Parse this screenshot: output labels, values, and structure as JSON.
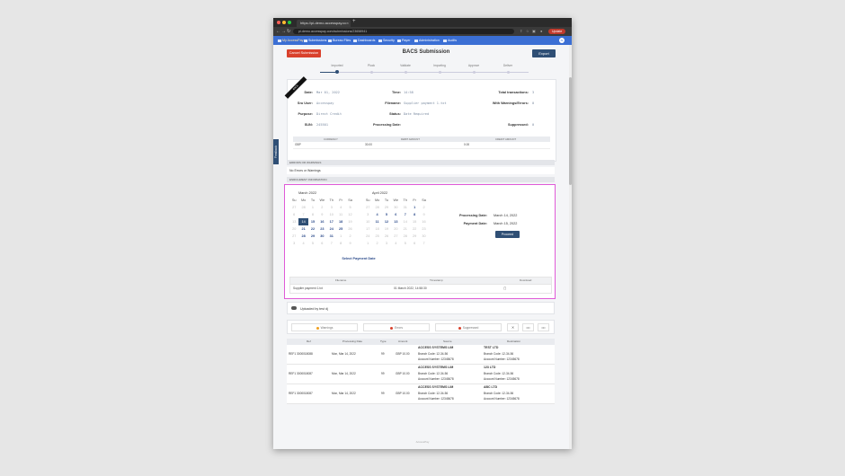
{
  "browser": {
    "tab_title": "https://pi-demo.accesspay.co",
    "tab_close": "×",
    "new_tab": "+",
    "url": "pi-demo.accesspay.com/submissions/23658941",
    "update_label": "Update"
  },
  "appnav": {
    "items": [
      {
        "label": "My AccessPay",
        "active": true
      },
      {
        "label": "Submissions"
      },
      {
        "label": "Bureau Files"
      },
      {
        "label": "Dashboards"
      },
      {
        "label": "Security"
      },
      {
        "label": "Payer"
      },
      {
        "label": "Administration"
      },
      {
        "label": "Audits"
      }
    ],
    "avatar": "IS"
  },
  "feedback_label": "Feedback",
  "header": {
    "cancel_label": "Cancel Submission",
    "title": "BACS Submission",
    "export_label": "Export"
  },
  "stepper": {
    "steps": [
      "Imported",
      "Pluck",
      "Validate",
      "Importing",
      "Approve",
      "Deliver"
    ],
    "active_index": 0
  },
  "summary": {
    "ribbon": "BACS",
    "date_label": "Date:",
    "date_value": "Mar 01, 2022",
    "time_label": "Time:",
    "time_value": "14:58",
    "total_tx_label": "Total transactions:",
    "total_tx_value": "3",
    "sru_label": "Sru User:",
    "sru_value": "Accesspay",
    "filename_label": "Filename:",
    "filename_value": "Supplier payment 1.txt",
    "warnings_label": "With Warnings/Errors:",
    "warnings_value": "0",
    "purpose_label": "Purpose:",
    "purpose_value": "Direct Credit",
    "status_label": "Status:",
    "status_value": "Date Required",
    "sun_label": "SUN:",
    "sun_value": "245501",
    "proc_date_label": "Processing Date:",
    "proc_date_value": "",
    "suppressed_label": "Suppressed:",
    "suppressed_value": "0",
    "money_table": {
      "headers": [
        "CURRENCY",
        "DEBIT AMOUNT",
        "CREDIT AMOUNT"
      ],
      "row": [
        "GBP",
        "30.00",
        "0.00"
      ]
    }
  },
  "sections": {
    "errors_title": "ERRORS OR WARNINGS",
    "errors_text": "No Errors or Warnings",
    "enrichment_title": "ENRICHMENT INFORMATION"
  },
  "calendar_march": {
    "title": "March 2022",
    "days": [
      "Su",
      "Mo",
      "Tu",
      "We",
      "Th",
      "Fr",
      "Sa"
    ],
    "cells": [
      {
        "d": "27",
        "s": "o"
      },
      {
        "d": "28",
        "s": "o"
      },
      {
        "d": "1",
        "s": "o"
      },
      {
        "d": "2",
        "s": "o"
      },
      {
        "d": "3",
        "s": "o"
      },
      {
        "d": "4",
        "s": "o"
      },
      {
        "d": "5",
        "s": "o"
      },
      {
        "d": "6",
        "s": "o"
      },
      {
        "d": "7",
        "s": "o"
      },
      {
        "d": "8",
        "s": "o"
      },
      {
        "d": "9",
        "s": "o"
      },
      {
        "d": "10",
        "s": "o"
      },
      {
        "d": "11",
        "s": "o"
      },
      {
        "d": "12",
        "s": "o"
      },
      {
        "d": "13",
        "s": "o"
      },
      {
        "d": "14",
        "s": "sel"
      },
      {
        "d": "15",
        "s": "cur"
      },
      {
        "d": "16",
        "s": "cur"
      },
      {
        "d": "17",
        "s": "cur"
      },
      {
        "d": "18",
        "s": "cur"
      },
      {
        "d": "19",
        "s": "o"
      },
      {
        "d": "20",
        "s": "o"
      },
      {
        "d": "21",
        "s": "cur"
      },
      {
        "d": "22",
        "s": "cur"
      },
      {
        "d": "23",
        "s": "cur"
      },
      {
        "d": "24",
        "s": "cur"
      },
      {
        "d": "25",
        "s": "cur"
      },
      {
        "d": "26",
        "s": "o"
      },
      {
        "d": "27",
        "s": "o"
      },
      {
        "d": "28",
        "s": "cur"
      },
      {
        "d": "29",
        "s": "cur"
      },
      {
        "d": "30",
        "s": "cur"
      },
      {
        "d": "31",
        "s": "cur"
      },
      {
        "d": "1",
        "s": "o"
      },
      {
        "d": "2",
        "s": "o"
      },
      {
        "d": "3",
        "s": "o"
      },
      {
        "d": "4",
        "s": "o"
      },
      {
        "d": "5",
        "s": "o"
      },
      {
        "d": "6",
        "s": "o"
      },
      {
        "d": "7",
        "s": "o"
      },
      {
        "d": "8",
        "s": "o"
      },
      {
        "d": "9",
        "s": "o"
      }
    ]
  },
  "calendar_april": {
    "title": "April 2022",
    "days": [
      "Su",
      "Mo",
      "Tu",
      "We",
      "Th",
      "Fr",
      "Sa"
    ],
    "cells": [
      {
        "d": "27",
        "s": "o"
      },
      {
        "d": "28",
        "s": "o"
      },
      {
        "d": "29",
        "s": "o"
      },
      {
        "d": "30",
        "s": "o"
      },
      {
        "d": "31",
        "s": "o"
      },
      {
        "d": "1",
        "s": "cur"
      },
      {
        "d": "2",
        "s": "o"
      },
      {
        "d": "3",
        "s": "o"
      },
      {
        "d": "4",
        "s": "cur"
      },
      {
        "d": "5",
        "s": "cur"
      },
      {
        "d": "6",
        "s": "cur"
      },
      {
        "d": "7",
        "s": "cur"
      },
      {
        "d": "8",
        "s": "cur"
      },
      {
        "d": "9",
        "s": "o"
      },
      {
        "d": "10",
        "s": "o"
      },
      {
        "d": "11",
        "s": "cur"
      },
      {
        "d": "12",
        "s": "cur"
      },
      {
        "d": "13",
        "s": "cur"
      },
      {
        "d": "14",
        "s": "o"
      },
      {
        "d": "15",
        "s": "o"
      },
      {
        "d": "16",
        "s": "o"
      },
      {
        "d": "17",
        "s": "o"
      },
      {
        "d": "18",
        "s": "o"
      },
      {
        "d": "19",
        "s": "o"
      },
      {
        "d": "20",
        "s": "o"
      },
      {
        "d": "21",
        "s": "o"
      },
      {
        "d": "22",
        "s": "o"
      },
      {
        "d": "23",
        "s": "o"
      },
      {
        "d": "24",
        "s": "o"
      },
      {
        "d": "25",
        "s": "o"
      },
      {
        "d": "26",
        "s": "o"
      },
      {
        "d": "27",
        "s": "o"
      },
      {
        "d": "28",
        "s": "o"
      },
      {
        "d": "29",
        "s": "o"
      },
      {
        "d": "30",
        "s": "o"
      },
      {
        "d": "1",
        "s": "o"
      },
      {
        "d": "2",
        "s": "o"
      },
      {
        "d": "3",
        "s": "o"
      },
      {
        "d": "4",
        "s": "o"
      },
      {
        "d": "5",
        "s": "o"
      },
      {
        "d": "6",
        "s": "o"
      },
      {
        "d": "7",
        "s": "o"
      }
    ]
  },
  "payment": {
    "processing_label": "Processing Date:",
    "processing_value": "March 14, 2022",
    "payment_label": "Payment Date:",
    "payment_value": "March 15, 2022",
    "proceed_label": "Proceed",
    "select_link": "Select Payment Date"
  },
  "file_table": {
    "headers": [
      "Filename",
      "Timestamp",
      "Download"
    ],
    "row": [
      "Supplier payment 1.txt",
      "01 March 2022, 14:58:30",
      "▢"
    ]
  },
  "upload_text": "Uploaded by test dj",
  "filters": {
    "warnings": "Warnings",
    "errors": "Errors",
    "suppressed": "Suppressed",
    "clear": "✕",
    "more1": "•••",
    "more2": "•••"
  },
  "submissions": {
    "headers": [
      "Ref",
      "Processing Date",
      "Type",
      "Amount",
      "Source",
      "Destination"
    ],
    "rows": [
      {
        "ref": "REF1 3000018088",
        "date": "Mon, Mar 14, 2022",
        "type": "99",
        "amount": "GBP 10.00",
        "src_name": "ACCESS SYSTEMS LIM",
        "src_branch": "Branch Code: 12-34-56",
        "src_account": "Account Number: 12345678",
        "dst_name": "TEST LTD",
        "dst_branch": "Branch Code: 12-34-56",
        "dst_account": "Account Number: 12345678"
      },
      {
        "ref": "REF1 3000018087",
        "date": "Mon, Mar 14, 2022",
        "type": "99",
        "amount": "GBP 10.00",
        "src_name": "ACCESS SYSTEMS LIM",
        "src_branch": "Branch Code: 12-34-56",
        "src_account": "Account Number: 12345678",
        "dst_name": "123 LTD",
        "dst_branch": "Branch Code: 12-34-56",
        "dst_account": "Account Number: 12345678"
      },
      {
        "ref": "REF1 3000018087",
        "date": "Mon, Mar 14, 2022",
        "type": "99",
        "amount": "GBP 10.00",
        "src_name": "ACCESS SYSTEMS LIM",
        "src_branch": "Branch Code: 12-34-56",
        "src_account": "Account Number: 12345678",
        "dst_name": "ABC LTD",
        "dst_branch": "Branch Code: 12-34-56",
        "dst_account": "Account Number: 12345678"
      }
    ]
  },
  "footer": "AccessPay",
  "colors": {
    "brand_blue": "#3b6fd4",
    "navy": "#2f4f75",
    "danger": "#d9412c",
    "highlight": "#e05bd8"
  }
}
